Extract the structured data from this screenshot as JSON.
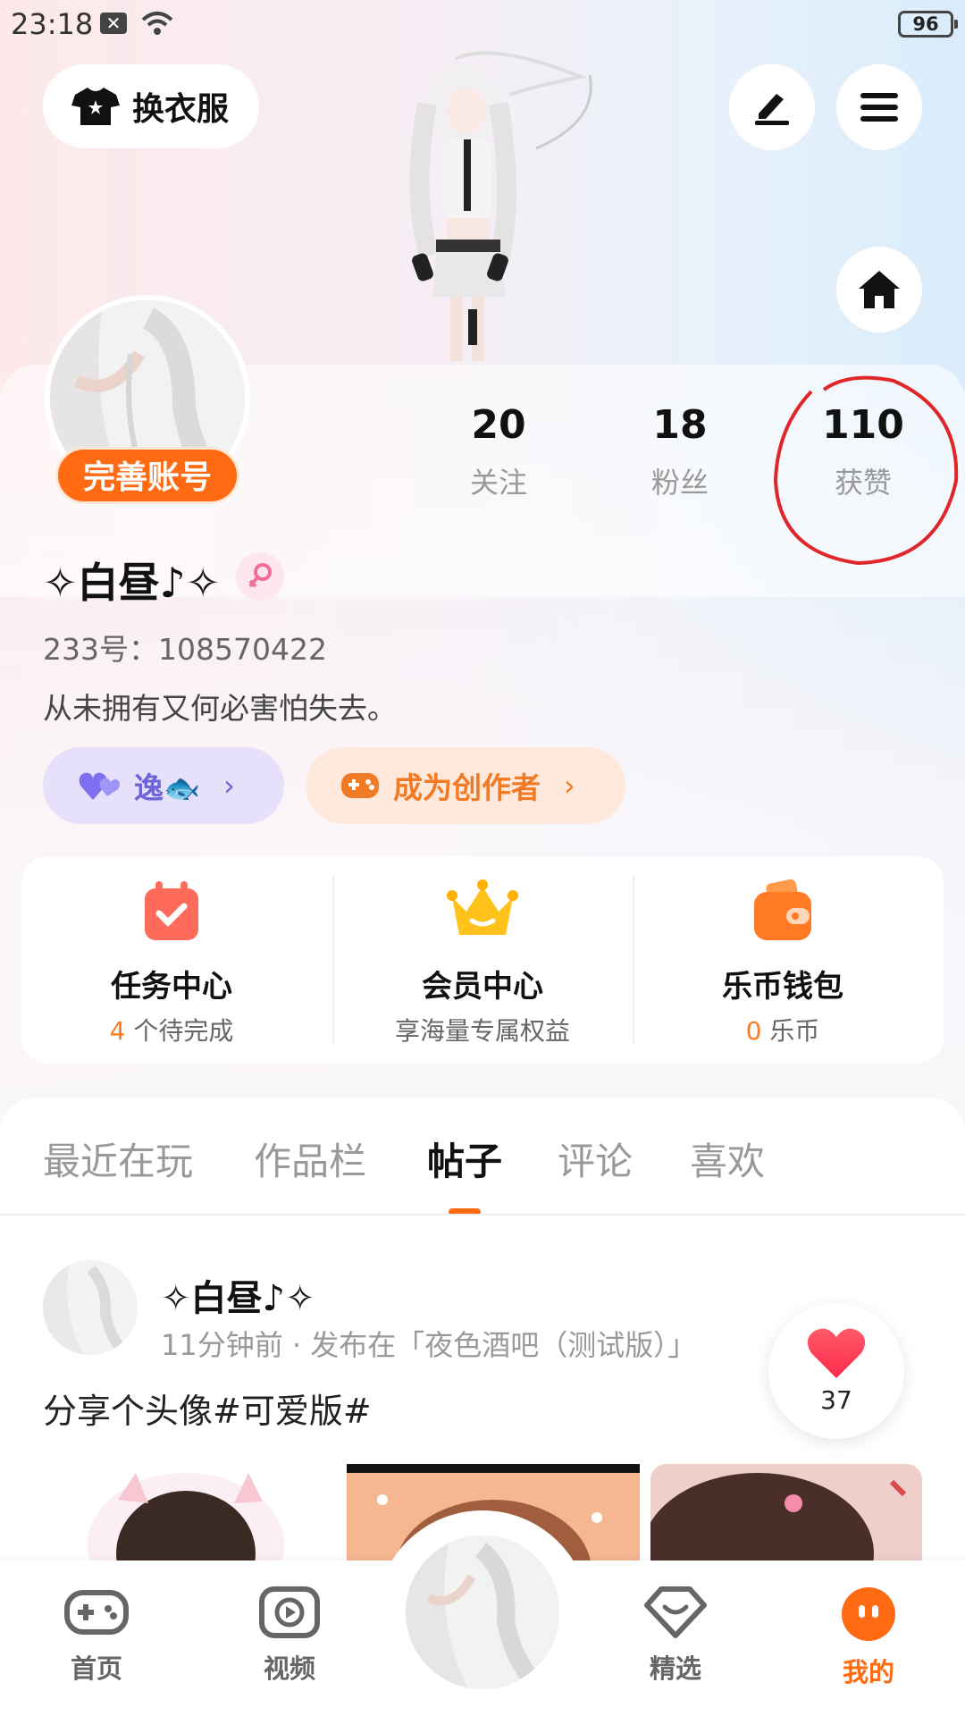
{
  "status_bar": {
    "time": "23:18",
    "battery": "96"
  },
  "header": {
    "outfit_label": "换衣服"
  },
  "profile": {
    "complete_label": "完善账号",
    "name": "✧白昼♪✧",
    "uid": "233号：108570422",
    "bio": "从未拥有又何必害怕失去。",
    "stats": [
      {
        "value": "20",
        "label": "关注"
      },
      {
        "value": "18",
        "label": "粉丝"
      },
      {
        "value": "110",
        "label": "获赞"
      }
    ],
    "fish_pill": {
      "label": "逸🐟"
    },
    "creator_pill": {
      "label": "成为创作者"
    }
  },
  "quick": [
    {
      "title": "任务中心",
      "sub_highlight": "4",
      "sub": "个待完成"
    },
    {
      "title": "会员中心",
      "sub_highlight": "",
      "sub": "享海量专属权益"
    },
    {
      "title": "乐币钱包",
      "sub_highlight": "0",
      "sub": "乐币"
    }
  ],
  "tabs": [
    "最近在玩",
    "作品栏",
    "帖子",
    "评论",
    "喜欢"
  ],
  "active_tab": "帖子",
  "post": {
    "author": "✧白昼♪✧",
    "meta": "11分钟前 · 发布在「夜色酒吧（测试版）」",
    "text": "分享个头像#可爱版#",
    "likes": "37"
  },
  "nav": [
    {
      "label": "首页"
    },
    {
      "label": "视频"
    },
    {
      "label": "精选"
    },
    {
      "label": "我的"
    }
  ],
  "colors": {
    "accent": "#ff6a12",
    "annotation": "#e0262a"
  }
}
